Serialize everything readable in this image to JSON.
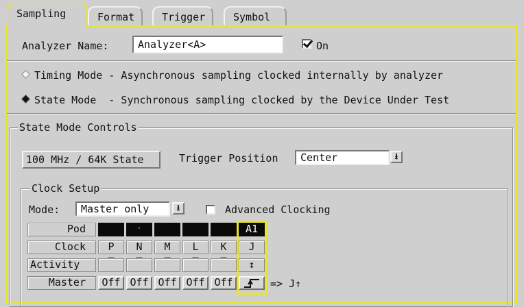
{
  "tabs": [
    {
      "label": "Sampling"
    },
    {
      "label": "Format"
    },
    {
      "label": "Trigger"
    },
    {
      "label": "Symbol"
    }
  ],
  "analyzer": {
    "name_label": "Analyzer Name:",
    "name_value": "Analyzer<A>",
    "on_checked": true,
    "on_label": "On"
  },
  "modes": {
    "timing_label": "Timing Mode - Asynchronous sampling clocked internally by analyzer",
    "state_label": "State Mode  - Synchronous sampling clocked by the Device Under Test",
    "selected": "state"
  },
  "state_controls": {
    "title": "State Mode Controls",
    "speed_label": "100 MHz / 64K State",
    "trigger_position_label": "Trigger Position",
    "trigger_position_value": "Center"
  },
  "clock_setup": {
    "title": "Clock Setup",
    "mode_label": "Mode:",
    "mode_value": "Master only",
    "advanced_label": "Advanced Clocking",
    "advanced_checked": false,
    "rows": {
      "pod": "Pod",
      "clock": "Clock",
      "activity": "Activity",
      "master": "Master"
    },
    "pods": [
      "",
      "•",
      "",
      "",
      "",
      "A1"
    ],
    "clocks": [
      "P",
      "N",
      "M",
      "L",
      "K",
      "J"
    ],
    "activity": [
      "‾",
      "‾",
      "‾",
      "‾",
      "‾",
      "↕"
    ],
    "master": [
      "Off",
      "Off",
      "Off",
      "Off",
      "Off",
      "↑"
    ],
    "result": "=> J↑"
  },
  "colors": {
    "highlight": "#e9e62a",
    "background": "#cfcfcf"
  }
}
